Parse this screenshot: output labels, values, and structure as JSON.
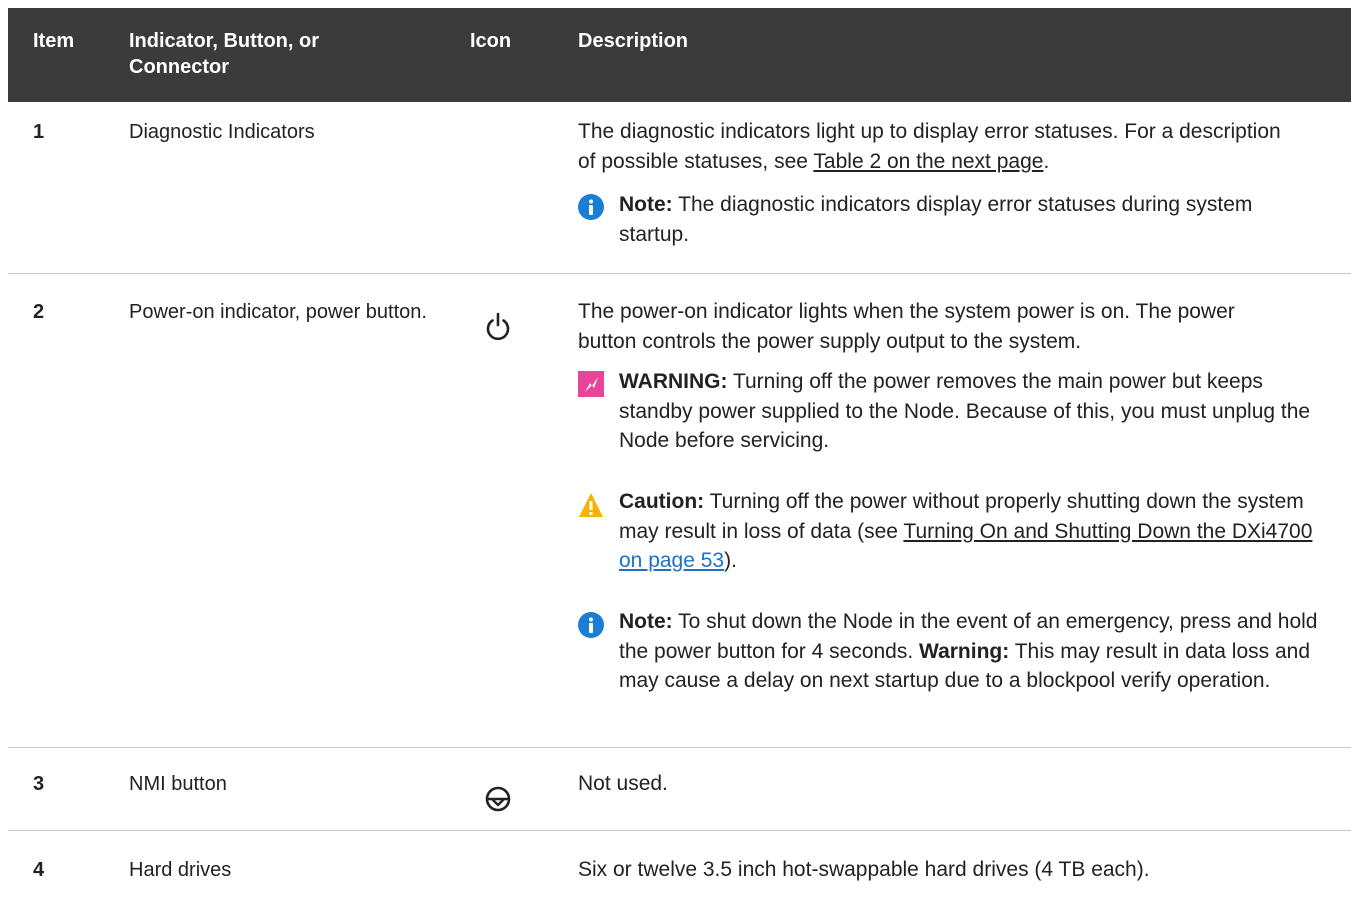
{
  "header": {
    "col_item": "Item",
    "col_indicator": "Indicator, Button, or Connector",
    "col_icon": "Icon",
    "col_description": "Description"
  },
  "rows": [
    {
      "item": "1",
      "name": "Diagnostic Indicators",
      "desc_text": "The diagnostic indicators light up to display error statuses. For a description of possible statuses, see ",
      "desc_link": "Table 2 on the next page",
      "desc_end": ".",
      "note_label": "Note:",
      "note_text": " The diagnostic indicators display error statuses during system startup."
    },
    {
      "item": "2",
      "name": "Power-on indicator, power button.",
      "icon": "power-icon",
      "desc_text": "The power-on indicator lights when the system power is on. The power button controls the power supply output to the system.",
      "warning_label": "WARNING:",
      "warning_text": " Turning off the power removes the main power but keeps standby power supplied to the Node. Because of this, you must unplug the Node before servicing.",
      "caution_label": "Caution:",
      "caution_text": " Turning off the power without properly shutting down the system may result in loss of data (see ",
      "caution_link": "Turning On and Shutting Down the DXi4700",
      "caution_page_link": "on page 53",
      "caution_end": ").",
      "note_label": "Note:",
      "note_text": " To shut down the Node in the event of an emergency, press and hold the power button for 4 seconds. ",
      "note_warning_label": "Warning:",
      "note_warning_text": " This may result in data loss and may cause a delay on next startup due to a blockpool verify operation."
    },
    {
      "item": "3",
      "name": "NMI button",
      "icon": "nmi-icon",
      "desc_text": "Not used."
    },
    {
      "item": "4",
      "name": "Hard drives",
      "desc_text": "Six or twelve 3.5 inch hot-swappable hard drives (4 TB each)."
    }
  ],
  "colors": {
    "header_bg": "#3b3b3b",
    "note_icon": "#1a7fd4",
    "warning_icon": "#e8449a",
    "caution_icon": "#f5b400",
    "link": "#1a73c9"
  }
}
